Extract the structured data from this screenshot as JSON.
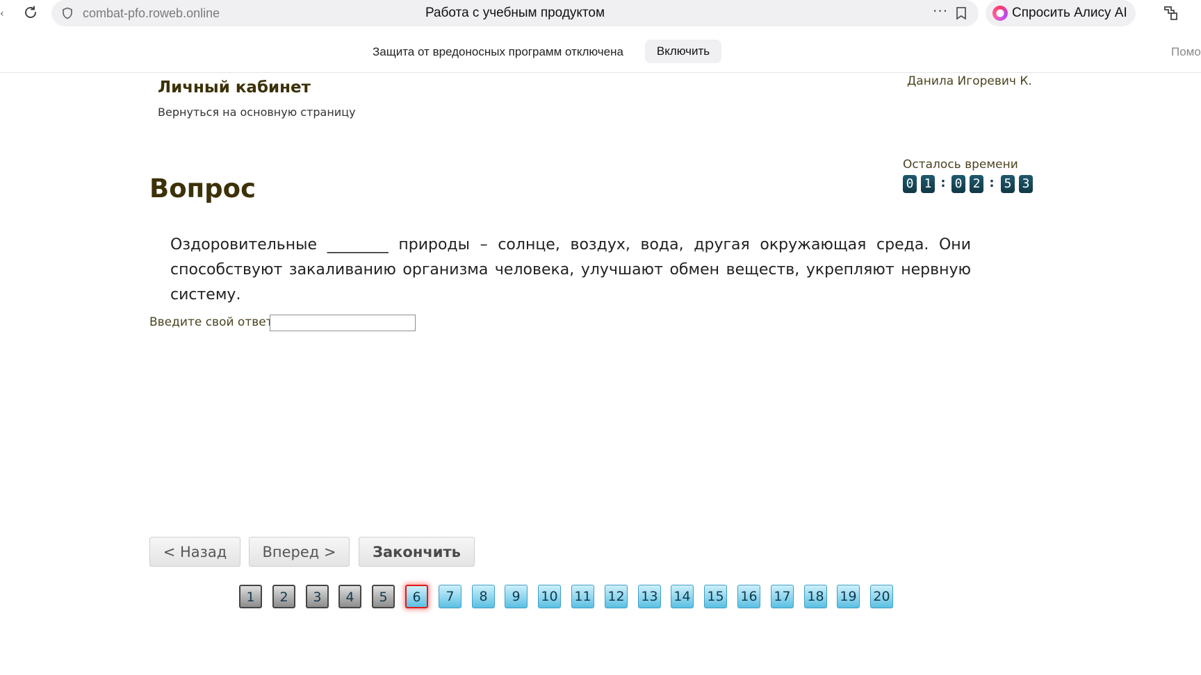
{
  "browser": {
    "url": "combat-pfo.roweb.online",
    "tab_title": "Работа с учебным продуктом",
    "alice_label": "Спросить Алису AI",
    "left_edge_text": "‹"
  },
  "notice": {
    "message": "Защита от вредоносных программ отключена",
    "enable_label": "Включить",
    "help_label": "Помощь"
  },
  "header": {
    "cabinet_title": "Личный кабинет",
    "back_link": "Вернуться на основную страницу",
    "user_name": "Данила Игоревич К."
  },
  "timer": {
    "label": "Осталось времени",
    "digits": [
      "0",
      "1",
      "0",
      "2",
      "5",
      "3"
    ],
    "separator": ":"
  },
  "question": {
    "title": "Вопрос",
    "text": "Оздоровительные ________ природы – солнце, воздух, вода, другая окружающая среда. Они способствуют закаливанию организма человека, улучшают обмен веществ, укрепляют нервную систему.",
    "answer_label": "Введите свой ответ",
    "answer_value": ""
  },
  "navigation": {
    "prev_label": "< Назад",
    "next_label": "Вперед >",
    "finish_label": "Закончить"
  },
  "pager": {
    "current": 6,
    "pages": [
      {
        "label": "1",
        "state": "visited"
      },
      {
        "label": "2",
        "state": "visited"
      },
      {
        "label": "3",
        "state": "visited"
      },
      {
        "label": "4",
        "state": "visited"
      },
      {
        "label": "5",
        "state": "visited"
      },
      {
        "label": "6",
        "state": "current"
      },
      {
        "label": "7",
        "state": "pending"
      },
      {
        "label": "8",
        "state": "pending"
      },
      {
        "label": "9",
        "state": "pending"
      },
      {
        "label": "10",
        "state": "pending"
      },
      {
        "label": "11",
        "state": "pending"
      },
      {
        "label": "12",
        "state": "pending"
      },
      {
        "label": "13",
        "state": "pending"
      },
      {
        "label": "14",
        "state": "pending"
      },
      {
        "label": "15",
        "state": "pending"
      },
      {
        "label": "16",
        "state": "pending"
      },
      {
        "label": "17",
        "state": "pending"
      },
      {
        "label": "18",
        "state": "pending"
      },
      {
        "label": "19",
        "state": "pending"
      },
      {
        "label": "20",
        "state": "pending"
      }
    ]
  },
  "colors": {
    "heading": "#3c3108",
    "timer_digit": "#1f5a6e",
    "current_page_border": "#e01a1a",
    "pending_page": "#8fd6ef",
    "visited_page": "#b8b8b8"
  }
}
